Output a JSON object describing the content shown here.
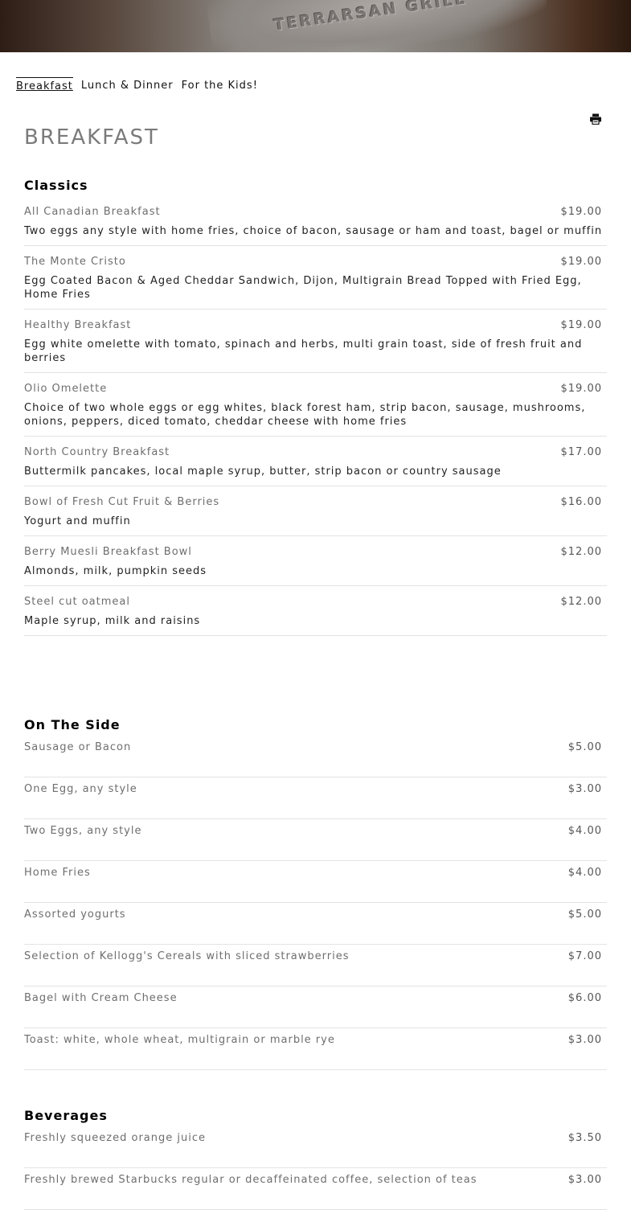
{
  "hero": {
    "emboss_text": "TERRARSAN GRILL"
  },
  "tabs": [
    {
      "label": "Breakfast",
      "active": true
    },
    {
      "label": "Lunch & Dinner",
      "active": false
    },
    {
      "label": "For the Kids!",
      "active": false
    }
  ],
  "page": {
    "title": "BREAKFAST",
    "print_icon": "printer-icon"
  },
  "sections": {
    "classics": {
      "title": "Classics",
      "items": [
        {
          "name": "All Canadian Breakfast",
          "price": "$19.00",
          "desc": "Two eggs any style with home fries, choice of bacon, sausage or ham and toast, bagel or muffin"
        },
        {
          "name": "The Monte Cristo",
          "price": "$19.00",
          "desc": "Egg Coated Bacon & Aged Cheddar Sandwich, Dijon, Multigrain Bread Topped with Fried Egg, Home Fries"
        },
        {
          "name": "Healthy Breakfast",
          "price": "$19.00",
          "desc": "Egg white omelette with tomato, spinach and herbs, multi grain toast, side of fresh fruit and berries"
        },
        {
          "name": "Olio Omelette",
          "price": "$19.00",
          "desc": "Choice of two whole eggs or egg whites, black forest ham, strip bacon, sausage, mushrooms, onions, peppers, diced tomato, cheddar cheese with home fries"
        },
        {
          "name": "North Country Breakfast",
          "price": "$17.00",
          "desc": "Buttermilk pancakes, local maple syrup, butter, strip bacon or country sausage"
        },
        {
          "name": "Bowl of Fresh Cut Fruit & Berries",
          "price": "$16.00",
          "desc": "Yogurt and muffin"
        },
        {
          "name": "Berry Muesli Breakfast Bowl",
          "price": "$12.00",
          "desc": "Almonds, milk, pumpkin seeds"
        },
        {
          "name": "Steel cut oatmeal",
          "price": "$12.00",
          "desc": "Maple syrup, milk and raisins"
        }
      ]
    },
    "side": {
      "title": "On The Side",
      "items": [
        {
          "name": "Sausage or Bacon",
          "price": "$5.00"
        },
        {
          "name": "One Egg, any style",
          "price": "$3.00"
        },
        {
          "name": "Two Eggs, any style",
          "price": "$4.00"
        },
        {
          "name": "Home Fries",
          "price": "$4.00"
        },
        {
          "name": "Assorted yogurts",
          "price": "$5.00"
        },
        {
          "name": "Selection of Kellogg's Cereals with sliced strawberries",
          "price": "$7.00"
        },
        {
          "name": "Bagel with Cream Cheese",
          "price": "$6.00"
        },
        {
          "name": "Toast: white, whole wheat, multigrain or marble rye",
          "price": "$3.00"
        }
      ]
    },
    "beverages": {
      "title": "Beverages",
      "items": [
        {
          "name": "Freshly squeezed orange juice",
          "price": "$3.50"
        },
        {
          "name": "Freshly brewed Starbucks regular or decaffeinated coffee, selection of teas",
          "price": "$3.00"
        }
      ]
    }
  }
}
